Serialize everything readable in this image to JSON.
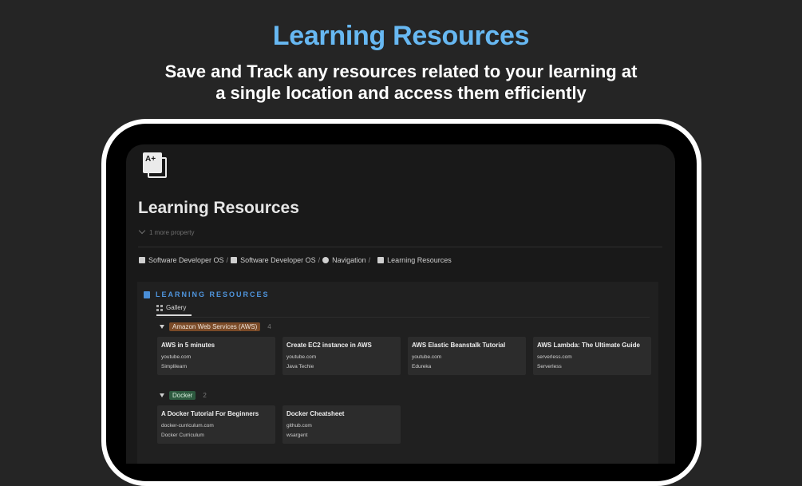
{
  "hero": {
    "title": "Learning Resources",
    "subtitle_line1": "Save and Track any resources related to your learning at",
    "subtitle_line2": "a single location and access them efficiently"
  },
  "page": {
    "icon_text": "A+",
    "title": "Learning Resources",
    "more_property": "1 more property"
  },
  "breadcrumb": [
    {
      "label": "Software Developer OS",
      "icon": "page-icon"
    },
    {
      "label": "Software Developer OS",
      "icon": "page-icon"
    },
    {
      "label": "Navigation",
      "icon": "compass-icon"
    },
    {
      "label": "Learning Resources",
      "icon": "document-icon"
    }
  ],
  "database": {
    "title": "LEARNING RESOURCES",
    "view_tab": "Gallery",
    "groups": [
      {
        "tag": "Amazon Web Services (AWS)",
        "count": "4",
        "cards": [
          {
            "title": "AWS in 5 minutes",
            "url": "youtube.com",
            "author": "Simplilearn"
          },
          {
            "title": "Create EC2 instance in AWS",
            "url": "youtube.com",
            "author": "Java Techie"
          },
          {
            "title": "AWS Elastic Beanstalk Tutorial",
            "url": "youtube.com",
            "author": "Edureka"
          },
          {
            "title": "AWS Lambda: The Ultimate Guide",
            "url": "serverless.com",
            "author": "Serverless"
          }
        ]
      },
      {
        "tag": "Docker",
        "count": "2",
        "cards": [
          {
            "title": "A Docker Tutorial For Beginners",
            "url": "docker-curriculum.com",
            "author": "Docker Curriculum"
          },
          {
            "title": "Docker Cheatsheet",
            "url": "github.com",
            "author": "wsargent"
          }
        ]
      }
    ]
  },
  "colors": {
    "hero_title": "#67b8f2",
    "aws_tag": "#7a4a27",
    "docker_tag": "#2d5a3f",
    "db_title": "#4f95dd"
  }
}
